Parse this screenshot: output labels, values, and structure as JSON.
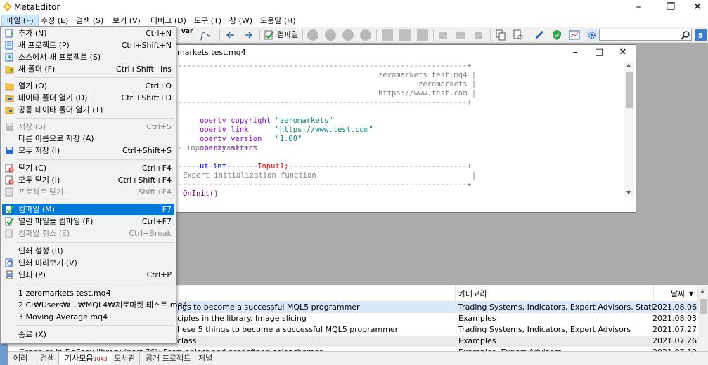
{
  "window": {
    "title": "MetaEditor"
  },
  "menubar": [
    {
      "label": "파일 (F)"
    },
    {
      "label": "수정 (E)"
    },
    {
      "label": "검색 (S)"
    },
    {
      "label": "보기 (V)"
    },
    {
      "label": "디버그 (D)"
    },
    {
      "label": "도구 (T)"
    },
    {
      "label": "창 (W)"
    },
    {
      "label": "도움말 (H)"
    }
  ],
  "toolbar": {
    "compile_label": "컴파일",
    "var_label": "var",
    "search_placeholder": ""
  },
  "file_menu": {
    "items": [
      {
        "label": "추가 (N)",
        "shortcut": "Ctrl+N",
        "icon": "new-file-icon"
      },
      {
        "label": "새 프로젝트 (P)",
        "shortcut": "Ctrl+Shift+N",
        "icon": "new-project-icon"
      },
      {
        "label": "소스에서 새 프로젝트 (S)",
        "shortcut": "",
        "icon": "project-from-source-icon"
      },
      {
        "label": "새 폴더 (F)",
        "shortcut": "Ctrl+Shift+Ins",
        "icon": "new-folder-icon"
      },
      {
        "label": "열기 (O)",
        "shortcut": "Ctrl+O",
        "icon": "open-folder-icon"
      },
      {
        "label": "데이타 폴더 열기 (D)",
        "shortcut": "Ctrl+Shift+D",
        "icon": "data-folder-icon"
      },
      {
        "label": "공통 데이타 폴더 열기 (T)",
        "shortcut": "",
        "icon": "common-folder-icon"
      },
      {
        "label": "저장 (S)",
        "shortcut": "Ctrl+S",
        "icon": "save-icon"
      },
      {
        "label": "다른 이름으로 저장 (A)",
        "shortcut": "",
        "icon": ""
      },
      {
        "label": "모두 저장 (I)",
        "shortcut": "Ctrl+Shift+S",
        "icon": "save-all-icon"
      },
      {
        "label": "닫기 (C)",
        "shortcut": "Ctrl+F4",
        "icon": "close-file-icon"
      },
      {
        "label": "모두 닫기 (I)",
        "shortcut": "Ctrl+Shift+F4",
        "icon": "close-all-icon"
      },
      {
        "label": "프로젝트 닫기",
        "shortcut": "Shift+F4",
        "icon": "close-project-icon"
      },
      {
        "label": "컴파일 (M)",
        "shortcut": "F7",
        "icon": "compile-icon"
      },
      {
        "label": "열린 파일들 컴파일 (F)",
        "shortcut": "Ctrl+F7",
        "icon": "compile-open-icon"
      },
      {
        "label": "컴파일 취소 (E)",
        "shortcut": "Ctrl+Break",
        "icon": "cancel-compile-icon"
      },
      {
        "label": "인쇄 설정 (R)",
        "shortcut": "",
        "icon": ""
      },
      {
        "label": "인쇄 미리보기 (V)",
        "shortcut": "",
        "icon": "print-preview-icon"
      },
      {
        "label": "인쇄 (P)",
        "shortcut": "Ctrl+P",
        "icon": "print-icon"
      },
      {
        "label": "1 zeromarkets test.mq4",
        "shortcut": "",
        "icon": ""
      },
      {
        "label": "2 C:₩Users₩...₩MQL4₩제로마켓 테스트.mq4",
        "shortcut": "",
        "icon": ""
      },
      {
        "label": "3 Moving Average.mq4",
        "shortcut": "",
        "icon": ""
      },
      {
        "label": "종료 (X)",
        "shortcut": "",
        "icon": ""
      }
    ]
  },
  "editor": {
    "title": "markets test.mq4",
    "lines": {
      "l1": "//+------------------------------------------------------------------+",
      "l2": "zeromarkets test.mq4 |",
      "l3": "zeromarkets |",
      "l4": "https://www.test.com |",
      "l5": "//+------------------------------------------------------------------+",
      "l6a": "operty",
      "l6b": "copyright",
      "l6c": "\"zeromarkets\"",
      "l7a": "operty",
      "l7b": "link",
      "l7c": "\"https://www.test.com\"",
      "l8a": "operty",
      "l8b": "version",
      "l8c": "\"1.00\"",
      "l9a": "operty",
      "l9b": "strict",
      "l10": "-- input parameters",
      "l11a": "ut",
      "l11b": "int",
      "l11c": "Input1;",
      "l12": "//+------------------------------------------------------------------+",
      "l13": "Expert initialization function                                   |",
      "l14": "//+------------------------------------------------------------------+",
      "l15": "OnInit()"
    }
  },
  "articles": {
    "columns": {
      "category": "카테고리",
      "date": "날짜"
    },
    "rows": [
      {
        "title": "ngs to become a successful MQL5 programmer",
        "category": "Trading Systems, Indicators, Expert Advisors, Statistics and anal...",
        "date": "2021.08.06"
      },
      {
        "title": "ciples in the library. Image slicing",
        "category": "Examples",
        "date": "2021.08.03"
      },
      {
        "title": "hese 5 things to become a successful MQL5 programmer",
        "category": "Trading Systems, Indicators, Expert Advisors",
        "date": "2021.07.27"
      },
      {
        "title": "class",
        "category": "Examples",
        "date": "2021.07.26"
      },
      {
        "title": "Graphics in DoEasy library (part 76): Form object and predefined color themes",
        "category": "Examples, Expert Advisors",
        "date": "2021.07.19"
      }
    ]
  },
  "tabs": [
    {
      "label": "에러"
    },
    {
      "label": "검색"
    },
    {
      "label": "기사모음",
      "badge": "1043"
    },
    {
      "label": "도서관"
    },
    {
      "label": "공개 프로젝트"
    },
    {
      "label": "저널"
    }
  ],
  "colors": {
    "accent": "#0078d7",
    "menu_bg": "#f2f2f2",
    "mdi_bg": "#ababab"
  }
}
